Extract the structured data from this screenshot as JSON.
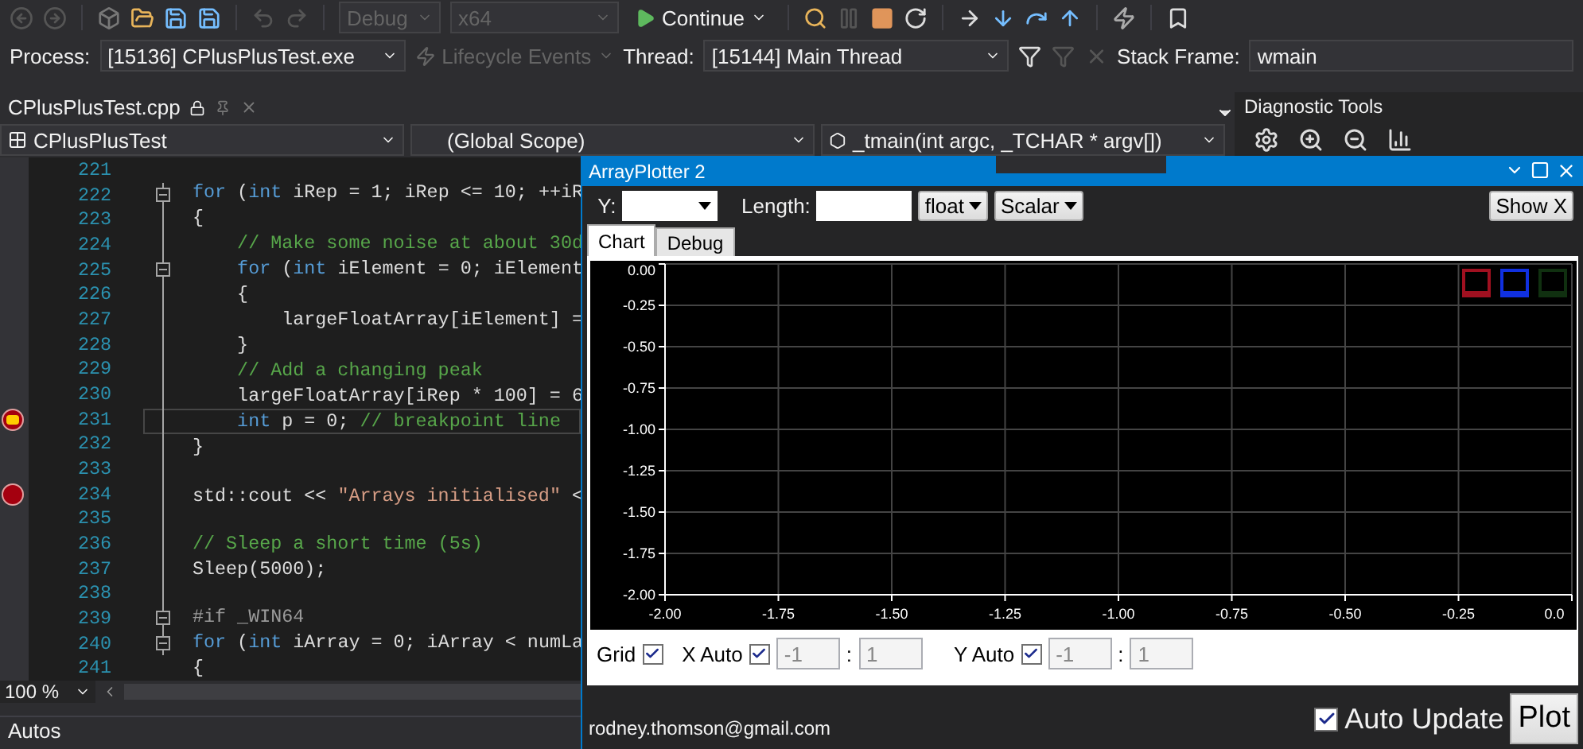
{
  "toolbar": {
    "configuration": {
      "value": "Debug",
      "disabled": true
    },
    "platform": {
      "value": "x64",
      "disabled": true
    },
    "continue": "Continue"
  },
  "debug_location": {
    "process_label": "Process:",
    "process": "[15136] CPlusPlusTest.exe",
    "lifecycle_events": {
      "label": "Lifecycle Events",
      "disabled": true
    },
    "thread_label": "Thread:",
    "thread": "[15144] Main Thread",
    "stack_frame_label": "Stack Frame:",
    "stack_frame": "wmain"
  },
  "editor": {
    "tab": "CPlusPlusTest.cpp",
    "project": "CPlusPlusTest",
    "scope": "(Global Scope)",
    "member": "_tmain(int argc, _TCHAR * argv[])",
    "zoom": "100 %",
    "lines": [
      {
        "number": "221",
        "collapsible": false,
        "breakpoint": false,
        "current": false
      },
      {
        "number": "222",
        "collapsible": true,
        "breakpoint": false,
        "current": false,
        "tokens": [
          {
            "kind": "keyword",
            "text": "for"
          },
          {
            "kind": "plain",
            "text": " ("
          },
          {
            "kind": "keyword",
            "text": "int"
          },
          {
            "kind": "plain",
            "text": " iRep = 1; iRep <= 10; ++iR"
          }
        ]
      },
      {
        "number": "223",
        "collapsible": false,
        "breakpoint": false,
        "current": false,
        "tokens": [
          {
            "kind": "plain",
            "text": "{"
          }
        ]
      },
      {
        "number": "224",
        "collapsible": false,
        "breakpoint": false,
        "current": false,
        "tokens": [
          {
            "kind": "comment",
            "text": "    // Make some noise at about 30d"
          }
        ]
      },
      {
        "number": "225",
        "collapsible": true,
        "breakpoint": false,
        "current": false,
        "tokens": [
          {
            "kind": "keyword",
            "text": "    for"
          },
          {
            "kind": "plain",
            "text": " ("
          },
          {
            "kind": "keyword",
            "text": "int"
          },
          {
            "kind": "plain",
            "text": " iElement = 0; iElement"
          }
        ]
      },
      {
        "number": "226",
        "collapsible": false,
        "breakpoint": false,
        "current": false,
        "tokens": [
          {
            "kind": "plain",
            "text": "    {"
          }
        ]
      },
      {
        "number": "227",
        "collapsible": false,
        "breakpoint": false,
        "current": false,
        "tokens": [
          {
            "kind": "plain",
            "text": "        largeFloatArray[iElement] ="
          }
        ]
      },
      {
        "number": "228",
        "collapsible": false,
        "breakpoint": false,
        "current": false,
        "tokens": [
          {
            "kind": "plain",
            "text": "    }"
          }
        ]
      },
      {
        "number": "229",
        "collapsible": false,
        "breakpoint": false,
        "current": false,
        "tokens": [
          {
            "kind": "comment",
            "text": "    // Add a changing peak"
          }
        ]
      },
      {
        "number": "230",
        "collapsible": false,
        "breakpoint": false,
        "current": false,
        "tokens": [
          {
            "kind": "plain",
            "text": "    largeFloatArray[iRep * 100] = 6"
          }
        ]
      },
      {
        "number": "231",
        "collapsible": false,
        "breakpoint": true,
        "current": true,
        "tokens": [
          {
            "kind": "keyword",
            "text": "    int"
          },
          {
            "kind": "plain",
            "text": " p = 0; "
          },
          {
            "kind": "comment",
            "text": "// breakpoint line"
          }
        ]
      },
      {
        "number": "232",
        "collapsible": false,
        "breakpoint": false,
        "current": false,
        "tokens": [
          {
            "kind": "plain",
            "text": "}"
          }
        ]
      },
      {
        "number": "233",
        "collapsible": false,
        "breakpoint": false,
        "current": false
      },
      {
        "number": "234",
        "collapsible": false,
        "breakpoint": true,
        "current": false,
        "tokens": [
          {
            "kind": "plain",
            "text": "std::cout << "
          },
          {
            "kind": "string",
            "text": "\"Arrays initialised\""
          },
          {
            "kind": "plain",
            "text": " <"
          }
        ]
      },
      {
        "number": "235",
        "collapsible": false,
        "breakpoint": false,
        "current": false
      },
      {
        "number": "236",
        "collapsible": false,
        "breakpoint": false,
        "current": false,
        "tokens": [
          {
            "kind": "comment",
            "text": "// Sleep a short time (5s)"
          }
        ]
      },
      {
        "number": "237",
        "collapsible": false,
        "breakpoint": false,
        "current": false,
        "tokens": [
          {
            "kind": "plain",
            "text": "Sleep(5000);"
          }
        ]
      },
      {
        "number": "238",
        "collapsible": false,
        "breakpoint": false,
        "current": false
      },
      {
        "number": "239",
        "collapsible": true,
        "breakpoint": false,
        "current": false,
        "tokens": [
          {
            "kind": "preprocessor",
            "text": "#if _WIN64"
          }
        ]
      },
      {
        "number": "240",
        "collapsible": true,
        "breakpoint": false,
        "current": false,
        "tokens": [
          {
            "kind": "keyword",
            "text": "for"
          },
          {
            "kind": "plain",
            "text": " ("
          },
          {
            "kind": "keyword",
            "text": "int"
          },
          {
            "kind": "plain",
            "text": " iArray = 0; iArray < numLa"
          }
        ]
      },
      {
        "number": "241",
        "collapsible": false,
        "breakpoint": false,
        "current": false,
        "tokens": [
          {
            "kind": "plain",
            "text": "{"
          }
        ]
      }
    ]
  },
  "diagnostic_tools": {
    "title": "Diagnostic Tools"
  },
  "autos": {
    "title": "Autos"
  },
  "plotter": {
    "title": "ArrayPlotter 2",
    "y_label": "Y:",
    "length_label": "Length:",
    "type": "float",
    "mode": "Scalar",
    "show_x": "Show X",
    "tabs": [
      {
        "label": "Chart",
        "selected": true
      },
      {
        "label": "Debug",
        "selected": false
      }
    ],
    "legend": [
      {
        "color": "#a01020"
      },
      {
        "color": "#1030e0"
      },
      {
        "color": "#103010"
      }
    ],
    "chart_data": {
      "type": "line",
      "grid": true,
      "xlim": [
        -2,
        0
      ],
      "ylim": [
        -2,
        0
      ],
      "xticks": [
        {
          "value": -2,
          "label": "-2.00"
        },
        {
          "value": -1.75,
          "label": "-1.75"
        },
        {
          "value": -1.5,
          "label": "-1.50"
        },
        {
          "value": -1.25,
          "label": "-1.25"
        },
        {
          "value": -1,
          "label": "-1.00"
        },
        {
          "value": -0.75,
          "label": "-0.75"
        },
        {
          "value": -0.5,
          "label": "-0.50"
        },
        {
          "value": -0.25,
          "label": "-0.25"
        },
        {
          "value": 0,
          "label": "0.0"
        }
      ],
      "yticks": [
        {
          "value": 0,
          "label": "0.00"
        },
        {
          "value": -0.25,
          "label": "-0.25"
        },
        {
          "value": -0.5,
          "label": "-0.50"
        },
        {
          "value": -0.75,
          "label": "-0.75"
        },
        {
          "value": -1,
          "label": "-1.00"
        },
        {
          "value": -1.25,
          "label": "-1.25"
        },
        {
          "value": -1.5,
          "label": "-1.50"
        },
        {
          "value": -1.75,
          "label": "-1.75"
        },
        {
          "value": -2,
          "label": "-2.00"
        }
      ]
    },
    "grid": {
      "label": "Grid",
      "checked": true
    },
    "x_auto": {
      "label": "X Auto",
      "checked": true,
      "min": "-1",
      "separator": ":",
      "max": "1"
    },
    "y_auto": {
      "label": "Y Auto",
      "checked": true,
      "min": "-1",
      "separator": ":",
      "max": "1"
    },
    "email": "rodney.thomson@gmail.com",
    "auto_update": {
      "label": "Auto Update",
      "checked": true
    },
    "plot": "Plot"
  }
}
